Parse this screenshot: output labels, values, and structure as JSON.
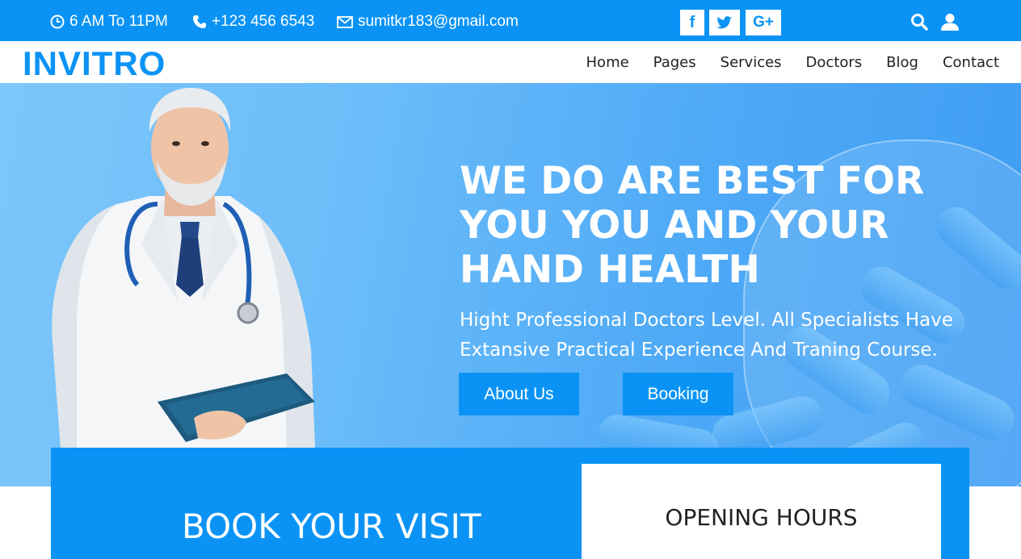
{
  "topbar": {
    "hours": "6 AM To 11PM",
    "phone": "+123 456 6543",
    "email": "sumitkr183@gmail.com",
    "social": {
      "facebook": "f",
      "twitter": "t",
      "googleplus": "G+"
    }
  },
  "nav": {
    "logo": "INVITRO",
    "links": [
      "Home",
      "Pages",
      "Services",
      "Doctors",
      "Blog",
      "Contact"
    ]
  },
  "hero": {
    "headline": "WE DO ARE BEST FOR YOU YOU AND YOUR HAND HEALTH",
    "subtext": "Hight Professional Doctors Level. All Specialists Have Extansive Practical Experience And Traning Course.",
    "buttons": {
      "about": "About Us",
      "booking": "Booking"
    }
  },
  "booking": {
    "title": "BOOK YOUR VISIT",
    "hours_title": "OPENING HOURS"
  },
  "colors": {
    "accent": "#0a93f5",
    "hero_light": "#7dc6fb",
    "text_dark": "#222222"
  },
  "icons": [
    "clock-icon",
    "phone-icon",
    "mail-icon",
    "facebook-icon",
    "twitter-icon",
    "google-plus-icon",
    "search-icon",
    "user-icon"
  ]
}
